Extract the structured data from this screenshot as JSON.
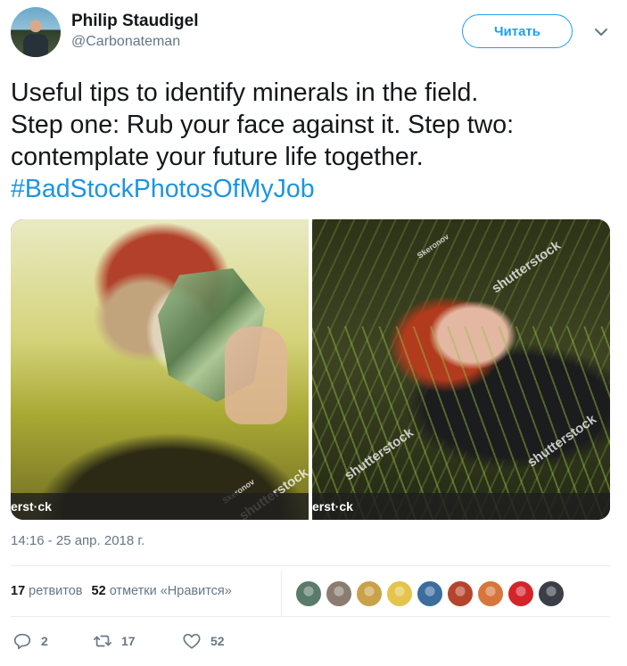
{
  "author": {
    "name": "Philip Staudigel",
    "handle": "@Carbonateman"
  },
  "follow_button": {
    "label": "Читать",
    "color": "#1da1f2"
  },
  "tweet": {
    "text": "Useful tips to identify minerals in the field.\nStep one: Rub your face against it. Step two:\ncontemplate your future life together.",
    "hashtag": "#BadStockPhotosOfMyJob",
    "hashtag_color": "#1b95e0"
  },
  "media": {
    "watermark_text": "shutterstock",
    "photographer_tag": "Skeronov",
    "strip_text": "erst·ck"
  },
  "timestamp": "14:16 - 25 апр. 2018 г.",
  "stats": {
    "retweets_count": "17",
    "retweets_label": "ретвитов",
    "likes_count": "52",
    "likes_label": "отметки «Нравится»"
  },
  "likers": [
    {
      "name": "liker-1",
      "color": "#5a7a6a"
    },
    {
      "name": "liker-2",
      "color": "#8a7d70"
    },
    {
      "name": "liker-3",
      "color": "#c9a14a"
    },
    {
      "name": "liker-4",
      "color": "#e4c44a"
    },
    {
      "name": "liker-5",
      "color": "#3b6d9e"
    },
    {
      "name": "liker-6",
      "color": "#b4442c"
    },
    {
      "name": "liker-7",
      "color": "#d8753c"
    },
    {
      "name": "liker-8",
      "color": "#d3242a"
    },
    {
      "name": "liker-9",
      "color": "#3a3f47"
    }
  ],
  "actions": {
    "replies": "2",
    "retweets": "17",
    "likes": "52"
  },
  "colors": {
    "secondary_text": "#657786",
    "divider": "#e6ecf0"
  }
}
